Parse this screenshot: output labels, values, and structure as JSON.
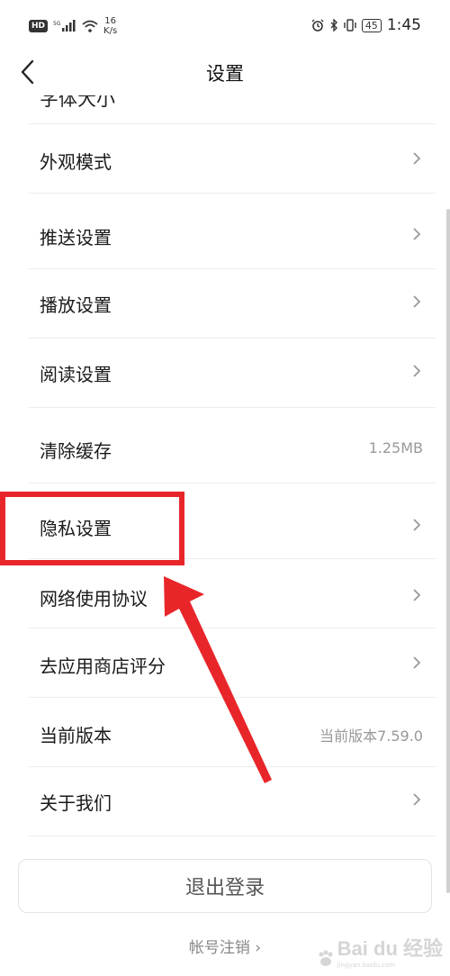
{
  "status_bar": {
    "hd_label": "HD",
    "net_speed_value": "16",
    "net_speed_unit": "K/s",
    "battery": "45",
    "time": "1:45"
  },
  "nav": {
    "title": "设置"
  },
  "settings": {
    "partial_label": "字体大小",
    "items": [
      {
        "label": "外观模式",
        "chevron": true
      },
      {
        "label": "推送设置",
        "chevron": true
      },
      {
        "label": "播放设置",
        "chevron": true
      },
      {
        "label": "阅读设置",
        "chevron": true
      },
      {
        "label": "清除缓存",
        "value": "1.25MB"
      },
      {
        "label": "隐私设置",
        "chevron": true
      },
      {
        "label": "网络使用协议",
        "chevron": true
      },
      {
        "label": "去应用商店评分",
        "chevron": true
      },
      {
        "label": "当前版本",
        "value": "当前版本7.59.0"
      },
      {
        "label": "关于我们",
        "chevron": true
      }
    ]
  },
  "logout": {
    "label": "退出登录"
  },
  "account_cancel": {
    "label": "帐号注销 ›"
  },
  "annotation": {
    "color": "#e8262a"
  },
  "watermark": {
    "text": "Bai du 经验",
    "sub": "jingyan.baidu.com"
  }
}
